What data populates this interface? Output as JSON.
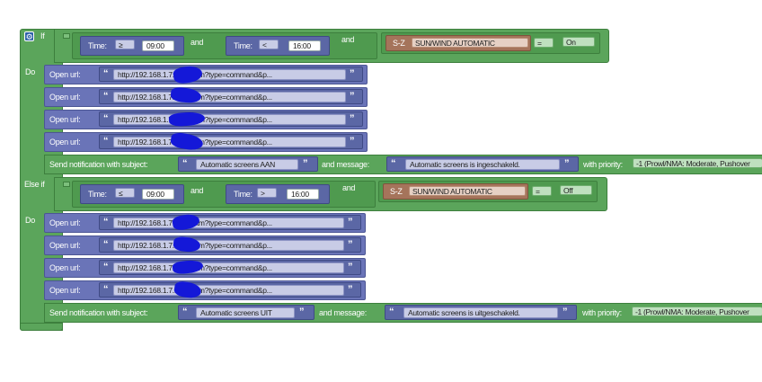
{
  "if_block": {
    "keyword": "If",
    "elseif_keyword": "Else if",
    "do_keyword": "Do"
  },
  "connector": "and",
  "conditions": [
    {
      "time_label": "Time:",
      "op1": "≥",
      "time1": "09:00",
      "time_label2": "Time:",
      "op2": "<",
      "time2": "16:00",
      "device_prefix": "S-Z",
      "device": "SUN/WIND AUTOMATIC",
      "eq": "=",
      "state": "On"
    },
    {
      "time_label": "Time:",
      "op1": "≤",
      "time1": "09:00",
      "time_label2": "Time:",
      "op2": ">",
      "time2": "16:00",
      "device_prefix": "S-Z",
      "device": "SUN/WIND AUTOMATIC",
      "eq": "=",
      "state": "Off"
    }
  ],
  "open_url_label": "Open url:",
  "quote_open": "“",
  "quote_close": "”",
  "urls_block1": [
    "http://192.168.1.7...json.htm?type=command&p...",
    "http://192.168.1.7...json.htm?type=command&p...",
    "http://192.168.1.7...json.htm?type=command&p...",
    "http://192.168.1.7...json.htm?type=command&p..."
  ],
  "urls_block2": [
    "http://192.168.1.7...json.htm?type=command&p...",
    "http://192.168.1.7...json.htm?type=command&p...",
    "http://192.168.1.7...json.htm?type=command&p...",
    "http://192.168.1.7...json.htm?type=command&p..."
  ],
  "notify": [
    {
      "label": "Send notification with subject:",
      "subject": "Automatic screens AAN",
      "msg_label": "and message:",
      "message": "Automatic screens is ingeschakeld.",
      "priority_label": "with priority:",
      "priority": "-1 (Prowl/NMA: Moderate, Pushover"
    },
    {
      "label": "Send notification with subject:",
      "subject": "Automatic screens UIT",
      "msg_label": "and message:",
      "message": "Automatic screens is uitgeschakeld.",
      "priority_label": "with priority:",
      "priority": "-1 (Prowl/NMA: Moderate, Pushover"
    }
  ],
  "colors": {
    "logic": "#5ba55b",
    "text": "#5b67a5",
    "device": "#a5745b"
  }
}
